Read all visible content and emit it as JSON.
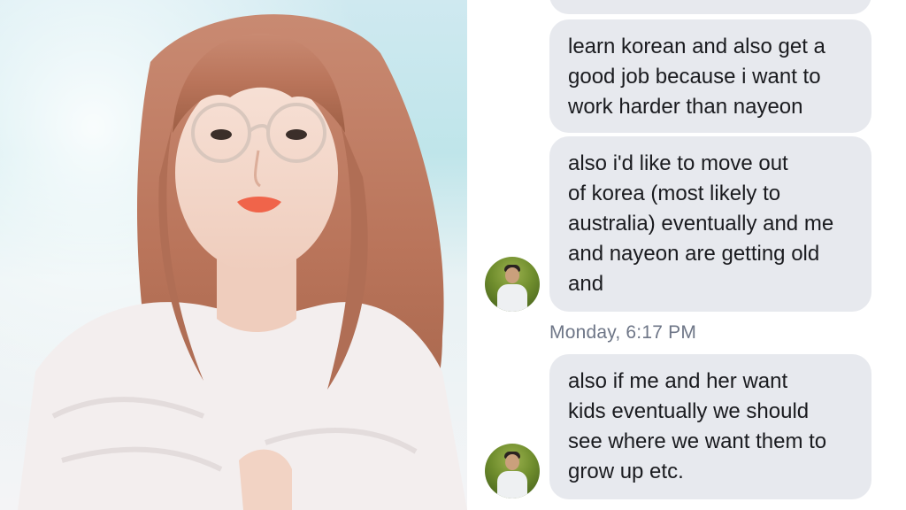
{
  "photo": {
    "icon": "portrait-photo"
  },
  "chat": {
    "messages": [
      {
        "lines": [
          ""
        ]
      },
      {
        "lines": [
          "learn korean and also get a",
          "good job because i want to",
          "work harder than nayeon"
        ]
      },
      {
        "lines": [
          "also i'd like to move out",
          "of korea (most likely to",
          "australia) eventually and me",
          "and nayeon are getting old",
          "and"
        ]
      },
      {
        "lines": [
          "also if me and her want",
          "kids eventually we should",
          "see where we want them to",
          "grow up etc."
        ]
      }
    ],
    "timestamp": "Monday, 6:17 PM",
    "colors": {
      "bubble": "#e7e9ee",
      "text": "#1a1b1f",
      "timestamp": "#6e7687"
    },
    "avatar_icon": "user-avatar"
  }
}
